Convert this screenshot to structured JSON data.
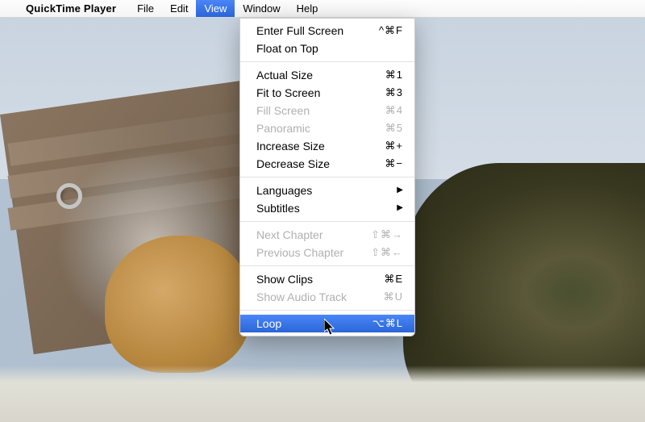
{
  "menubar": {
    "app_name": "QuickTime Player",
    "items": [
      {
        "label": "File",
        "open": false
      },
      {
        "label": "Edit",
        "open": false
      },
      {
        "label": "View",
        "open": true
      },
      {
        "label": "Window",
        "open": false
      },
      {
        "label": "Help",
        "open": false
      }
    ]
  },
  "dropdown": {
    "groups": [
      [
        {
          "label": "Enter Full Screen",
          "shortcut": "^⌘F",
          "disabled": false,
          "submenu": false,
          "highlighted": false
        },
        {
          "label": "Float on Top",
          "shortcut": "",
          "disabled": false,
          "submenu": false,
          "highlighted": false
        }
      ],
      [
        {
          "label": "Actual Size",
          "shortcut": "⌘1",
          "disabled": false,
          "submenu": false,
          "highlighted": false
        },
        {
          "label": "Fit to Screen",
          "shortcut": "⌘3",
          "disabled": false,
          "submenu": false,
          "highlighted": false
        },
        {
          "label": "Fill Screen",
          "shortcut": "⌘4",
          "disabled": true,
          "submenu": false,
          "highlighted": false
        },
        {
          "label": "Panoramic",
          "shortcut": "⌘5",
          "disabled": true,
          "submenu": false,
          "highlighted": false
        },
        {
          "label": "Increase Size",
          "shortcut": "⌘+",
          "disabled": false,
          "submenu": false,
          "highlighted": false
        },
        {
          "label": "Decrease Size",
          "shortcut": "⌘−",
          "disabled": false,
          "submenu": false,
          "highlighted": false
        }
      ],
      [
        {
          "label": "Languages",
          "shortcut": "",
          "disabled": false,
          "submenu": true,
          "highlighted": false
        },
        {
          "label": "Subtitles",
          "shortcut": "",
          "disabled": false,
          "submenu": true,
          "highlighted": false
        }
      ],
      [
        {
          "label": "Next Chapter",
          "shortcut": "⇧⌘→",
          "disabled": true,
          "submenu": false,
          "highlighted": false
        },
        {
          "label": "Previous Chapter",
          "shortcut": "⇧⌘←",
          "disabled": true,
          "submenu": false,
          "highlighted": false
        }
      ],
      [
        {
          "label": "Show Clips",
          "shortcut": "⌘E",
          "disabled": false,
          "submenu": false,
          "highlighted": false
        },
        {
          "label": "Show Audio Track",
          "shortcut": "⌘U",
          "disabled": true,
          "submenu": false,
          "highlighted": false
        }
      ],
      [
        {
          "label": "Loop",
          "shortcut": "⌥⌘L",
          "disabled": false,
          "submenu": false,
          "highlighted": true
        }
      ]
    ]
  }
}
